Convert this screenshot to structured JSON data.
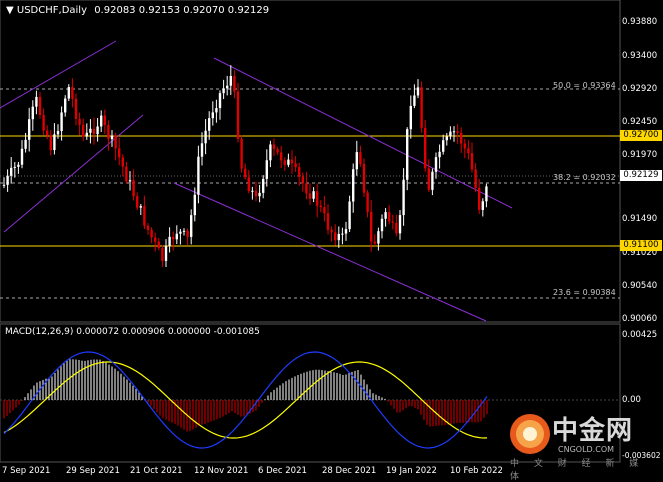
{
  "header": {
    "title": "USDCHF,Daily",
    "ohlc": "0.92083 0.92153 0.92070 0.92129"
  },
  "macd": {
    "label": "MACD(12,26,9) 0.000072 0.000906 0.000000 -0.001085"
  },
  "price_axis": [
    "0.93880",
    "0.93400",
    "0.92920",
    "0.92450",
    "0.91970",
    "0.91490",
    "0.91020",
    "0.90540",
    "0.90060"
  ],
  "macd_axis": [
    "0.00425",
    "0.00",
    "-0.003602"
  ],
  "levels": {
    "resistance": "0.92700",
    "support": "0.91100",
    "current": "0.92129"
  },
  "fib": {
    "f50": "50.0 = 0.93364",
    "f38": "38.2 = 0.92032",
    "f23": "23.6 = 0.90384"
  },
  "dates": [
    "7 Sep 2021",
    "29 Sep 2021",
    "21 Oct 2021",
    "12 Nov 2021",
    "6 Dec 2021",
    "28 Dec 2021",
    "19 Jan 2022",
    "10 Feb 2022"
  ],
  "logo": {
    "cn": "中金网",
    "en": "CNGOLD.COM",
    "sub": "中 文 财 经 新 媒 体"
  },
  "colors": {
    "resistance": "#ffd700",
    "support": "#ffd700",
    "channel": "#8b2fd6",
    "bull": "#ffffff",
    "bear": "#e00000",
    "macd_signal": "#ffff00",
    "macd_line": "#1e3cff"
  }
}
